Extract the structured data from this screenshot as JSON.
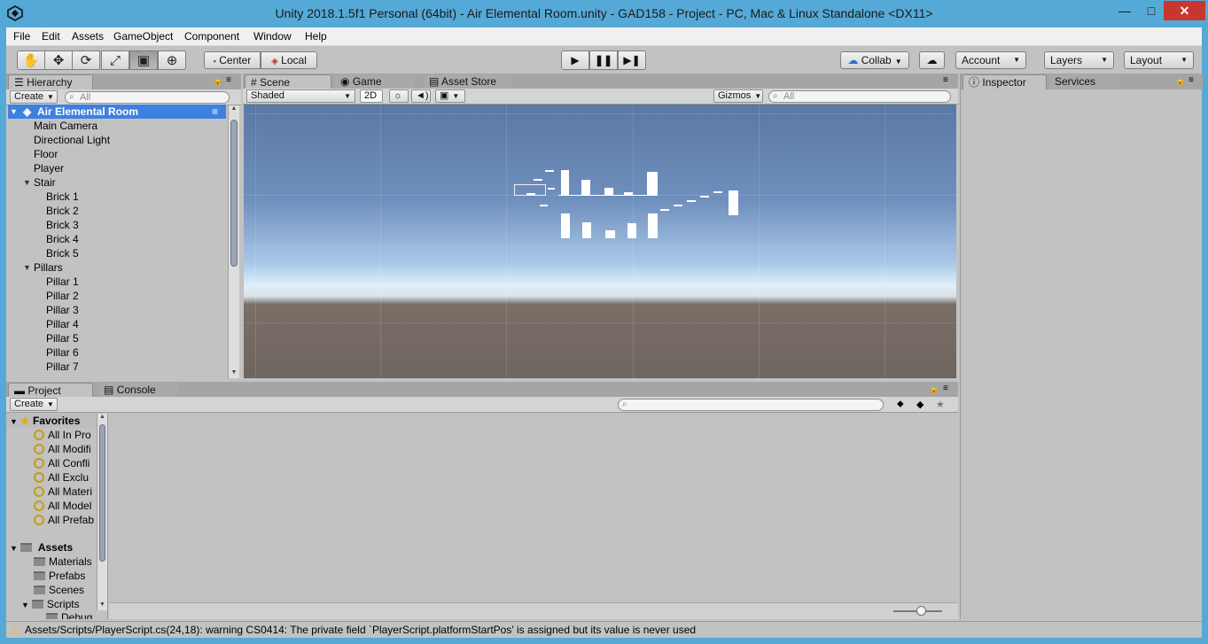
{
  "window": {
    "title": "Unity 2018.1.5f1 Personal (64bit) - Air Elemental Room.unity - GAD158 - Project - PC, Mac & Linux Standalone <DX11>",
    "minimize": "—",
    "maximize": "□",
    "close": "✕"
  },
  "menu": [
    "File",
    "Edit",
    "Assets",
    "GameObject",
    "Component",
    "Window",
    "Help"
  ],
  "toolbar": {
    "pivot_label": "Center",
    "space_label": "Local",
    "collab_label": "Collab",
    "account_label": "Account",
    "layers_label": "Layers",
    "layout_label": "Layout"
  },
  "hierarchy": {
    "tab_label": "Hierarchy",
    "create_label": "Create",
    "search_placeholder": "All",
    "scene_name": "Air Elemental Room",
    "items": [
      {
        "label": "Main Camera"
      },
      {
        "label": "Directional Light"
      },
      {
        "label": "Floor"
      },
      {
        "label": "Player"
      },
      {
        "label": "Stair"
      },
      {
        "label": "Brick 1"
      },
      {
        "label": "Brick 2"
      },
      {
        "label": "Brick 3"
      },
      {
        "label": "Brick 4"
      },
      {
        "label": "Brick 5"
      },
      {
        "label": "Pillars"
      },
      {
        "label": "Pillar 1"
      },
      {
        "label": "Pillar 2"
      },
      {
        "label": "Pillar 3"
      },
      {
        "label": "Pillar 4"
      },
      {
        "label": "Pillar 5"
      },
      {
        "label": "Pillar 6"
      },
      {
        "label": "Pillar 7"
      }
    ]
  },
  "scene": {
    "tabs": [
      "Scene",
      "Game",
      "Asset Store"
    ],
    "shading_mode": "Shaded",
    "mode_2d": "2D",
    "gizmos_label": "Gizmos",
    "search_placeholder": "All"
  },
  "inspector": {
    "tabs": [
      "Inspector",
      "Services"
    ]
  },
  "project": {
    "tabs": [
      "Project",
      "Console"
    ],
    "create_label": "Create",
    "favorites_label": "Favorites",
    "favorites": [
      "All In Pro",
      "All Modifi",
      "All Confli",
      "All Exclu",
      "All Materi",
      "All Model",
      "All Prefab"
    ],
    "assets_label": "Assets",
    "folders": [
      "Materials",
      "Prefabs",
      "Scenes",
      "Scripts",
      "Debug"
    ]
  },
  "status": {
    "message": "Assets/Scripts/PlayerScript.cs(24,18): warning CS0414: The private field `PlayerScript.platformStartPos' is assigned but its value is never used"
  },
  "colors": {
    "titlebar": "#55a9d6",
    "selection": "#3d80df",
    "warning": "#f2c200"
  }
}
